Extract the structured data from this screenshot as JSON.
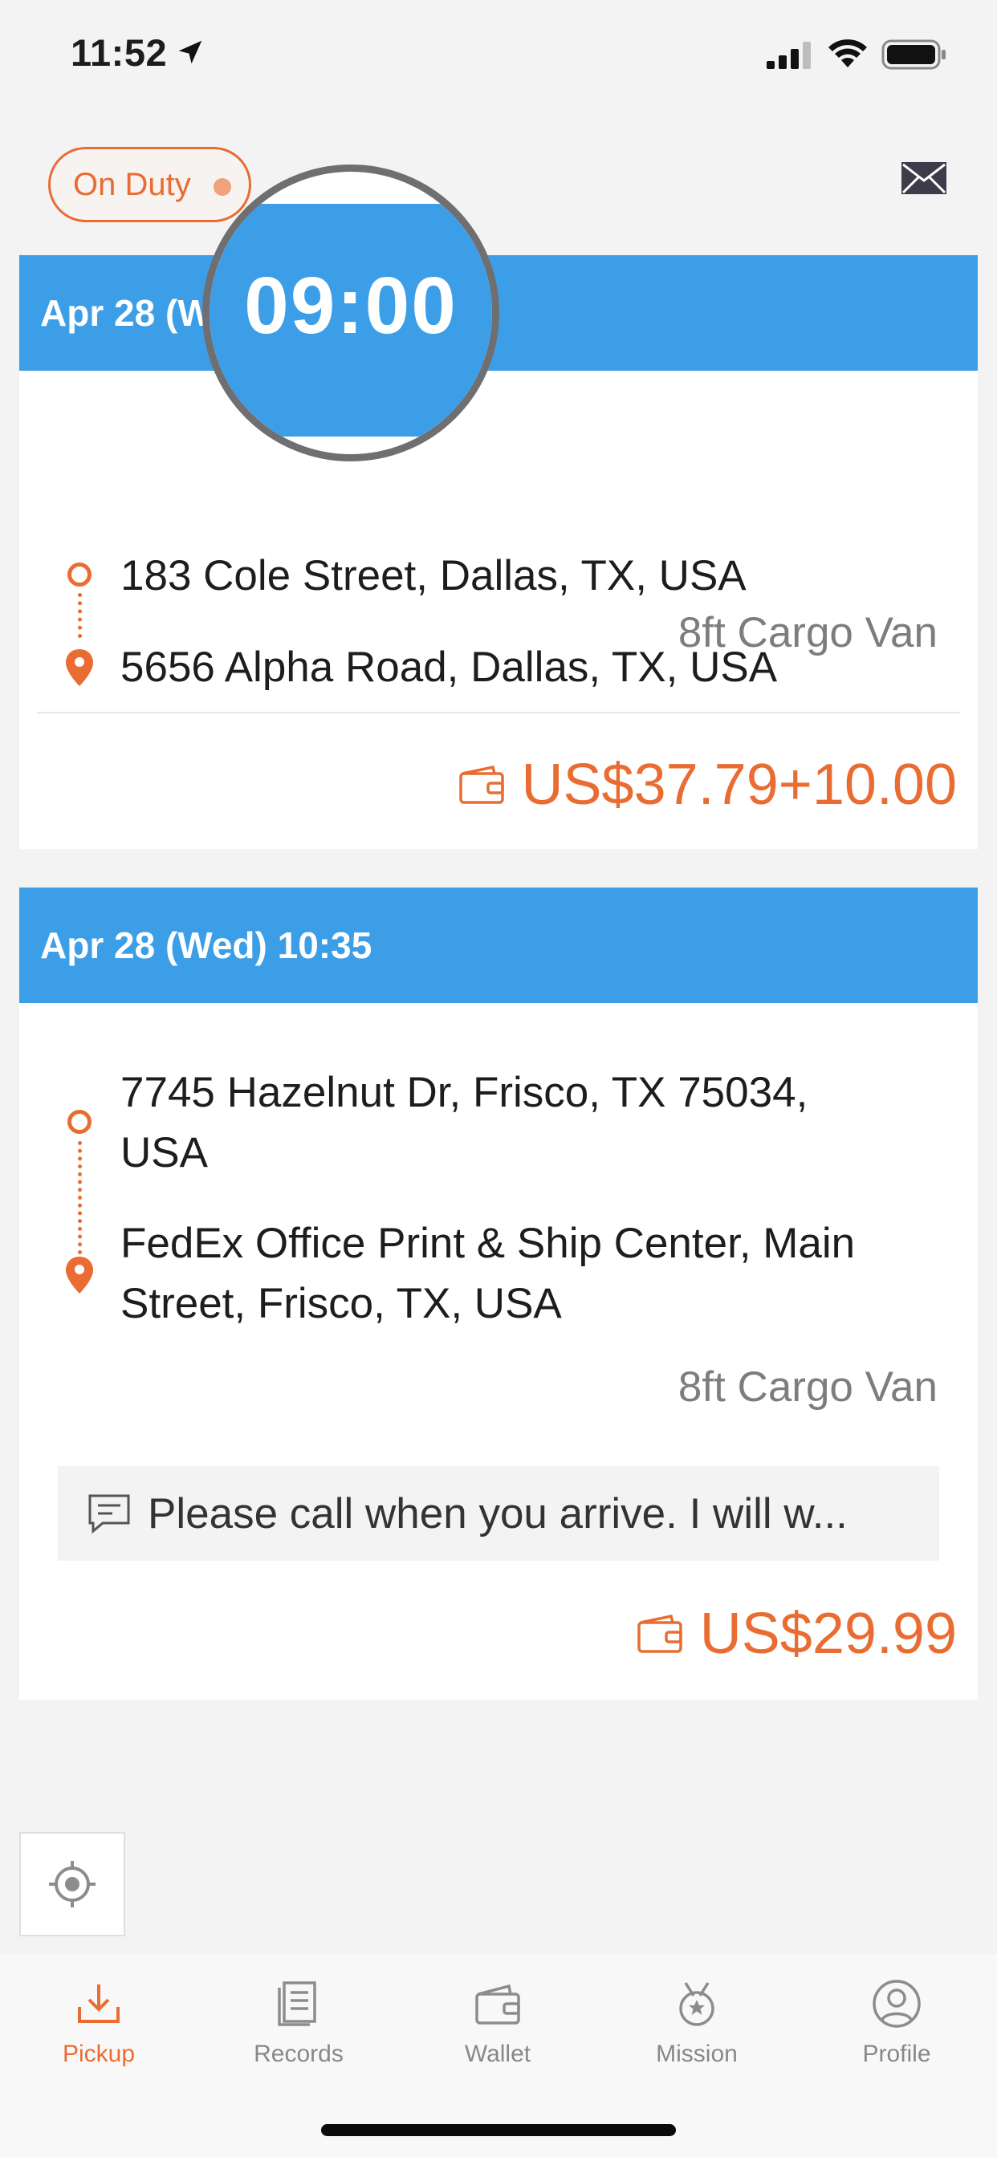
{
  "status_bar": {
    "time": "11:52"
  },
  "header": {
    "duty_label": "On Duty"
  },
  "magnifier": {
    "text": "09:00"
  },
  "orders": [
    {
      "datetime": "Apr 28 (W",
      "pickup": "183 Cole Street, Dallas, TX, USA",
      "dropoff": "5656 Alpha Road, Dallas, TX, USA",
      "vehicle": "8ft Cargo Van",
      "price": "US$37.79+10.00"
    },
    {
      "datetime": "Apr 28 (Wed) 10:35",
      "pickup_line1": "7745 Hazelnut Dr, Frisco, TX 75034,",
      "pickup_line2": "USA",
      "dropoff_line1": "FedEx Office Print & Ship Center, Main",
      "dropoff_line2": "Street, Frisco, TX, USA",
      "vehicle": "8ft Cargo Van",
      "note": "Please call when you arrive. I will w...",
      "price": "US$29.99"
    }
  ],
  "tabs": [
    {
      "label": "Pickup",
      "icon": "download-icon",
      "active": true
    },
    {
      "label": "Records",
      "icon": "records-icon",
      "active": false
    },
    {
      "label": "Wallet",
      "icon": "wallet-icon",
      "active": false
    },
    {
      "label": "Mission",
      "icon": "medal-icon",
      "active": false
    },
    {
      "label": "Profile",
      "icon": "profile-icon",
      "active": false
    }
  ],
  "colors": {
    "accent": "#e96d32",
    "header_blue": "#3d9ee8",
    "background": "#f3f3f4"
  }
}
